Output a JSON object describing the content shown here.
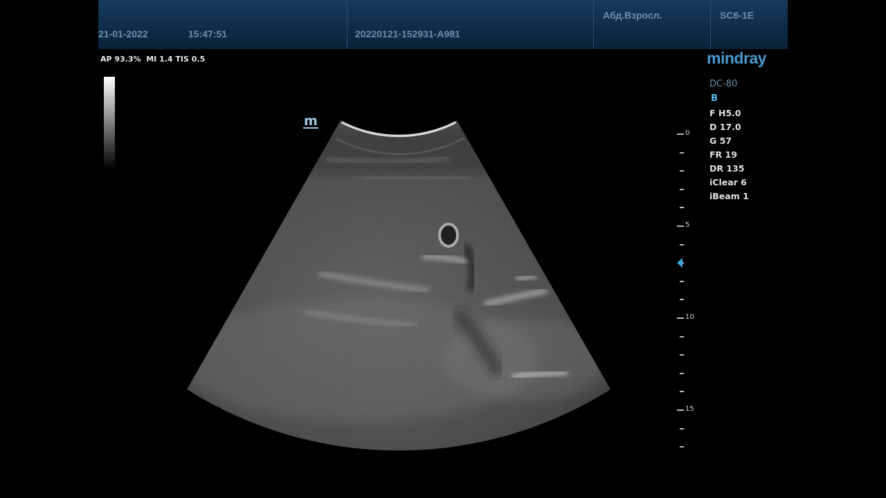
{
  "header": {
    "date": "21-01-2022",
    "time": "15:47:51",
    "exam_id": "20220121-152931-A981",
    "preset": "Абд.Взросл.",
    "probe": "SC6-1E"
  },
  "acoustic": {
    "text": "AP 93.3%  MI 1.4 TIS 0.5"
  },
  "logo": "mindray",
  "device": {
    "model": "DC-80",
    "mode": "B",
    "params": [
      "F H5.0",
      "D 17.0",
      "G 57",
      "FR 19",
      "DR 135",
      "iClear 6",
      "iBeam 1"
    ]
  },
  "orientation_marker": "m",
  "depth_scale": {
    "labels": [
      "0",
      "5",
      "10",
      "15"
    ],
    "max_depth": 17.0,
    "focus_depth": 7
  },
  "colors": {
    "header_bg": "#0c2944",
    "header_text": "#6f8fad",
    "logo": "#4a9ad0",
    "mode": "#5ab4e6",
    "focus_marker": "#3fa8e0"
  }
}
